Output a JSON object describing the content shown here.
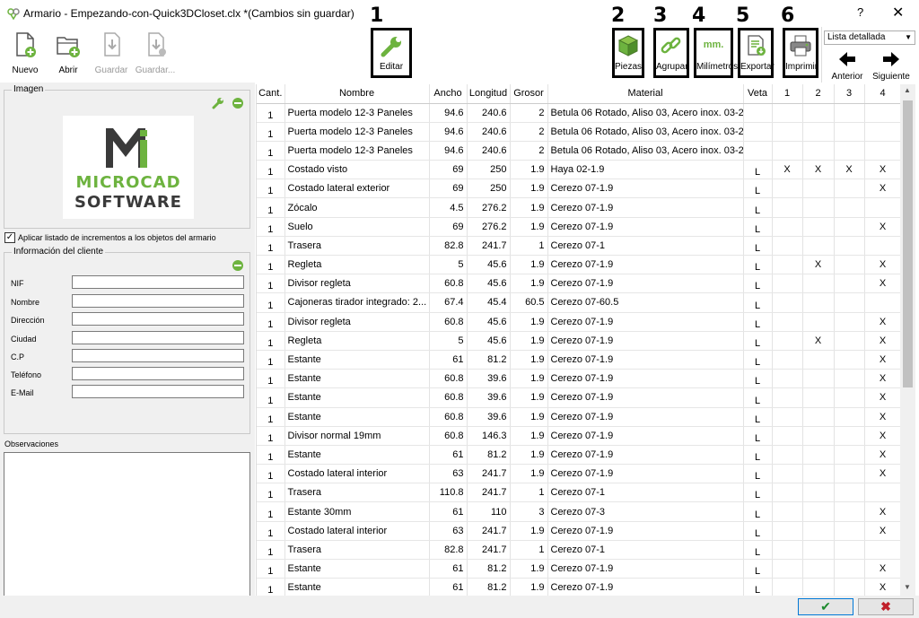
{
  "window": {
    "title": "Armario - Empezando-con-Quick3DCloset.clx *(Cambios sin guardar)",
    "help": "?",
    "close": "✕"
  },
  "toolbar": {
    "nuevo": "Nuevo",
    "abrir": "Abrir",
    "guardar": "Guardar",
    "guardar_como": "Guardar...",
    "editar": "Editar",
    "piezas": "Piezas",
    "agrupar": "Agrupar",
    "milimetros": "Milímetros",
    "mm_glyph": "mm.",
    "exportar": "Exportar",
    "imprimir": "Imprimir",
    "anterior": "Anterior",
    "siguiente": "Siguiente",
    "view_select": "Lista detallada"
  },
  "annotations": [
    "1",
    "2",
    "3",
    "4",
    "5",
    "6"
  ],
  "left": {
    "imagen_title": "Imagen",
    "logo_line1": "MICROCAD",
    "logo_line2": "SOFTWARE",
    "apply_checkbox": "Aplicar listado de incrementos a los objetos del armario",
    "cliente_title": "Información del cliente",
    "fields": [
      "NIF",
      "Nombre",
      "Dirección",
      "Ciudad",
      "C.P",
      "Teléfono",
      "E-Mail"
    ],
    "observaciones": "Observaciones"
  },
  "table": {
    "headers": [
      "Cant.",
      "Nombre",
      "Ancho",
      "Longitud",
      "Grosor",
      "Material",
      "Veta",
      "1",
      "2",
      "3",
      "4"
    ],
    "rows": [
      [
        "1",
        "Puerta modelo 12-3 Paneles",
        "94.6",
        "240.6",
        "2",
        "Betula 06 Rotado, Aliso 03, Acero inox. 03-2",
        "",
        "",
        "",
        "",
        ""
      ],
      [
        "1",
        "Puerta modelo 12-3 Paneles",
        "94.6",
        "240.6",
        "2",
        "Betula 06 Rotado, Aliso 03, Acero inox. 03-2",
        "",
        "",
        "",
        "",
        ""
      ],
      [
        "1",
        "Puerta modelo 12-3 Paneles",
        "94.6",
        "240.6",
        "2",
        "Betula 06 Rotado, Aliso 03, Acero inox. 03-2",
        "",
        "",
        "",
        "",
        ""
      ],
      [
        "1",
        "Costado visto",
        "69",
        "250",
        "1.9",
        "Haya 02-1.9",
        "L",
        "X",
        "X",
        "X",
        "X"
      ],
      [
        "1",
        "Costado lateral exterior",
        "69",
        "250",
        "1.9",
        "Cerezo 07-1.9",
        "L",
        "",
        "",
        "",
        "X"
      ],
      [
        "1",
        "Zócalo",
        "4.5",
        "276.2",
        "1.9",
        "Cerezo 07-1.9",
        "L",
        "",
        "",
        "",
        ""
      ],
      [
        "1",
        "Suelo",
        "69",
        "276.2",
        "1.9",
        "Cerezo 07-1.9",
        "L",
        "",
        "",
        "",
        "X"
      ],
      [
        "1",
        "Trasera",
        "82.8",
        "241.7",
        "1",
        "Cerezo 07-1",
        "L",
        "",
        "",
        "",
        ""
      ],
      [
        "1",
        "Regleta",
        "5",
        "45.6",
        "1.9",
        "Cerezo 07-1.9",
        "L",
        "",
        "X",
        "",
        "X"
      ],
      [
        "1",
        "Divisor regleta",
        "60.8",
        "45.6",
        "1.9",
        "Cerezo 07-1.9",
        "L",
        "",
        "",
        "",
        "X"
      ],
      [
        "1",
        "Cajoneras tirador integrado: 2...",
        "67.4",
        "45.4",
        "60.5",
        "Cerezo 07-60.5",
        "L",
        "",
        "",
        "",
        ""
      ],
      [
        "1",
        "Divisor regleta",
        "60.8",
        "45.6",
        "1.9",
        "Cerezo 07-1.9",
        "L",
        "",
        "",
        "",
        "X"
      ],
      [
        "1",
        "Regleta",
        "5",
        "45.6",
        "1.9",
        "Cerezo 07-1.9",
        "L",
        "",
        "X",
        "",
        "X"
      ],
      [
        "1",
        "Estante",
        "61",
        "81.2",
        "1.9",
        "Cerezo 07-1.9",
        "L",
        "",
        "",
        "",
        "X"
      ],
      [
        "1",
        "Estante",
        "60.8",
        "39.6",
        "1.9",
        "Cerezo 07-1.9",
        "L",
        "",
        "",
        "",
        "X"
      ],
      [
        "1",
        "Estante",
        "60.8",
        "39.6",
        "1.9",
        "Cerezo 07-1.9",
        "L",
        "",
        "",
        "",
        "X"
      ],
      [
        "1",
        "Estante",
        "60.8",
        "39.6",
        "1.9",
        "Cerezo 07-1.9",
        "L",
        "",
        "",
        "",
        "X"
      ],
      [
        "1",
        "Divisor normal 19mm",
        "60.8",
        "146.3",
        "1.9",
        "Cerezo 07-1.9",
        "L",
        "",
        "",
        "",
        "X"
      ],
      [
        "1",
        "Estante",
        "61",
        "81.2",
        "1.9",
        "Cerezo 07-1.9",
        "L",
        "",
        "",
        "",
        "X"
      ],
      [
        "1",
        "Costado lateral interior",
        "63",
        "241.7",
        "1.9",
        "Cerezo 07-1.9",
        "L",
        "",
        "",
        "",
        "X"
      ],
      [
        "1",
        "Trasera",
        "110.8",
        "241.7",
        "1",
        "Cerezo 07-1",
        "L",
        "",
        "",
        "",
        ""
      ],
      [
        "1",
        "Estante 30mm",
        "61",
        "110",
        "3",
        "Cerezo 07-3",
        "L",
        "",
        "",
        "",
        "X"
      ],
      [
        "1",
        "Costado lateral interior",
        "63",
        "241.7",
        "1.9",
        "Cerezo 07-1.9",
        "L",
        "",
        "",
        "",
        "X"
      ],
      [
        "1",
        "Trasera",
        "82.8",
        "241.7",
        "1",
        "Cerezo 07-1",
        "L",
        "",
        "",
        "",
        ""
      ],
      [
        "1",
        "Estante",
        "61",
        "81.2",
        "1.9",
        "Cerezo 07-1.9",
        "L",
        "",
        "",
        "",
        "X"
      ],
      [
        "1",
        "Estante",
        "61",
        "81.2",
        "1.9",
        "Cerezo 07-1.9",
        "L",
        "",
        "",
        "",
        "X"
      ]
    ]
  },
  "dialog": {
    "ok": "✔",
    "cancel": "✖"
  },
  "colors": {
    "accent_green": "#6db33f",
    "logo_dark": "#3a3a3a",
    "ok_green": "#1e8a2e",
    "cancel_red": "#c0202a"
  }
}
